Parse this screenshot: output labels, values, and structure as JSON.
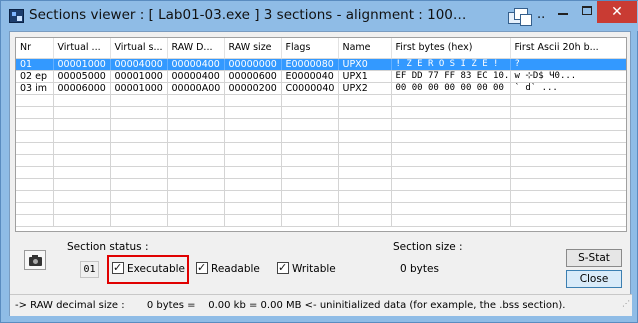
{
  "window": {
    "title": "Sections viewer : [ Lab01-03.exe ] 3 sections - alignment : 1000h [ Lab01-02.e",
    "title_ellipsis": "..",
    "close_glyph": "✕"
  },
  "table": {
    "columns": [
      "Nr",
      "Virtual ...",
      "Virtual s...",
      "RAW D...",
      "RAW size",
      "Flags",
      "Name",
      "First bytes (hex)",
      "First Ascii 20h b..."
    ],
    "rows": [
      [
        "01",
        "00001000",
        "00004000",
        "00000400",
        "00000000",
        "E0000080",
        "UPX0",
        "! Z E R O   S I Z E !",
        "?"
      ],
      [
        "02 ep",
        "00005000",
        "00001000",
        "00000400",
        "00000600",
        "E0000040",
        "UPX1",
        "EF DD 77 FF 83 EC 10...",
        "w  ⊹D$  Ч0..."
      ],
      [
        "03 im",
        "00006000",
        "00001000",
        "00000A00",
        "00000200",
        "C0000040",
        "UPX2",
        "00 00 00 00 00 00 00 ...",
        "` d`   ..."
      ]
    ],
    "selected_row": 0,
    "empty_row_count": 11
  },
  "section_status": {
    "label": "Section status :",
    "number": "01",
    "executable_label": "Executable",
    "readable_label": "Readable",
    "writable_label": "Writable",
    "executable": true,
    "readable": true,
    "writable": true
  },
  "section_size": {
    "label": "Section size :",
    "value": "0 bytes"
  },
  "buttons": {
    "sstat": "S-Stat",
    "close": "Close"
  },
  "statusbar": {
    "text": "-> RAW decimal size :       0 bytes =    0.00 kb = 0.00 MB <- uninitialized data (for example, the .bss section)."
  },
  "colors": {
    "selection": "#3399ff",
    "highlight_box": "#e00000",
    "titlebar": "#8fbce6",
    "close_button": "#c93b33"
  }
}
